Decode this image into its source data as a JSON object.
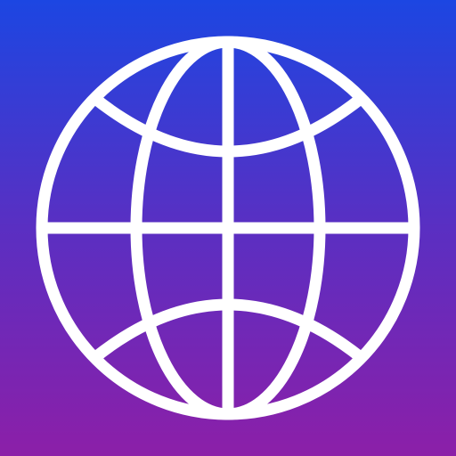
{
  "icon": {
    "name": "globe-icon",
    "background_gradient": {
      "top": "#1c46e2",
      "middle": "#5a2fc2",
      "bottom": "#8c1fa8"
    },
    "stroke_color": "#ffffff"
  }
}
